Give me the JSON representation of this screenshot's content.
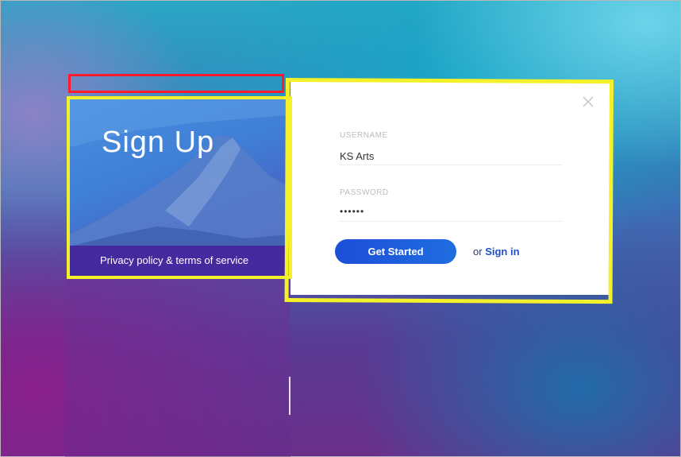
{
  "signup": {
    "title": "Sign Up",
    "privacy_link": "Privacy policy & terms of service"
  },
  "form": {
    "username_label": "USERNAME",
    "username_value": "KS Arts",
    "password_label": "PASSWORD",
    "password_value": "••••••",
    "submit_label": "Get Started",
    "or_text": "or",
    "signin_label": "Sign in",
    "close_icon": "close-icon"
  },
  "annotations": {
    "star": "*",
    "highlight_colors": {
      "red": "#ff1a2e",
      "yellow": "#f4f12a"
    }
  },
  "theme": {
    "accent": "#1d4ed8",
    "privacy_bar": "#46149a"
  }
}
